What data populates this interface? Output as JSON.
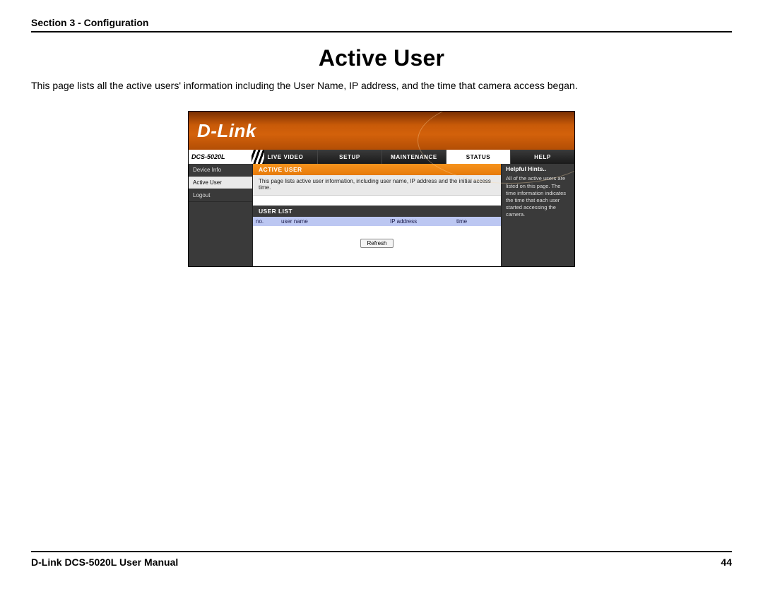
{
  "section_header": "Section 3 - Configuration",
  "page_title": "Active User",
  "intro": "This page lists all the active users' information including the User Name, IP address, and the time that camera access began.",
  "router": {
    "brand": "D-Link",
    "model": "DCS-5020L",
    "tabs": [
      "LIVE VIDEO",
      "SETUP",
      "MAINTENANCE",
      "STATUS",
      "HELP"
    ],
    "active_tab_index": 3,
    "sidebar": [
      "Device Info",
      "Active User",
      "Logout"
    ],
    "selected_sidebar_index": 1,
    "panel_title": "ACTIVE USER",
    "panel_desc": "This page lists active user information, including user name, IP address and the initial access time.",
    "panel_sub": "USER LIST",
    "columns": [
      "no.",
      "user name",
      "IP address",
      "time"
    ],
    "refresh_label": "Refresh",
    "hints_title": "Helpful Hints..",
    "hints_body": "All of the active users are listed on this page. The time information indicates the time that each user started accessing the camera."
  },
  "footer": {
    "left": "D-Link DCS-5020L User Manual",
    "right": "44"
  }
}
